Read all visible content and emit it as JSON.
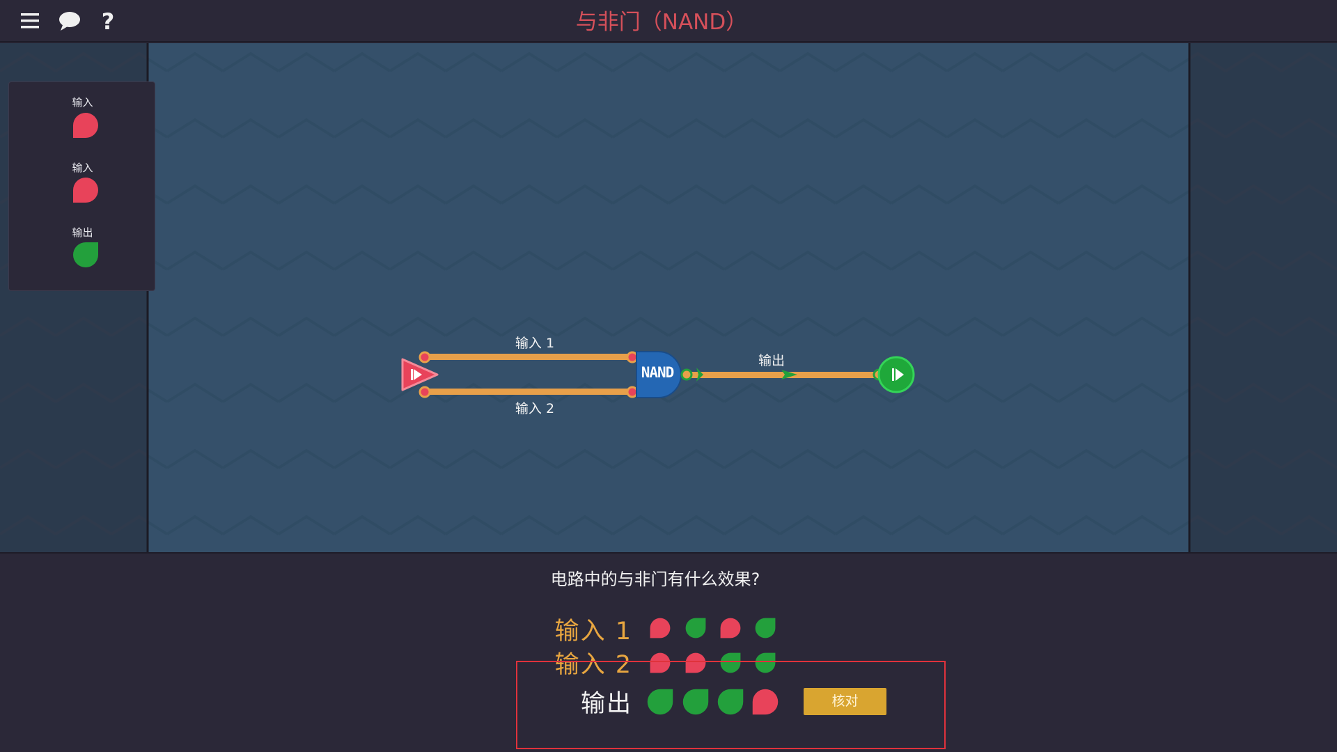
{
  "header": {
    "title": "与非门（NAND）",
    "icons": [
      "menu-icon",
      "chat-icon",
      "help-icon"
    ]
  },
  "palette": {
    "items": [
      {
        "label": "输入",
        "color": "red"
      },
      {
        "label": "输入",
        "color": "red"
      },
      {
        "label": "输出",
        "color": "green"
      }
    ]
  },
  "circuit": {
    "gate_label": "NAND",
    "wire_labels": {
      "input1": "输入 1",
      "input2": "输入 2",
      "output": "输出"
    }
  },
  "quiz": {
    "question": "电路中的与非门有什么效果?",
    "rows": [
      {
        "label": "输入 1",
        "values": [
          "red",
          "green",
          "red",
          "green"
        ]
      },
      {
        "label": "输入 2",
        "values": [
          "red",
          "red",
          "green",
          "green"
        ]
      },
      {
        "label": "输出",
        "values": [
          "green",
          "green",
          "green",
          "red"
        ]
      }
    ],
    "check_label": "核对"
  },
  "colors": {
    "red": "#e8435a",
    "green": "#23a03c",
    "wire": "#e8a04a",
    "accent_title": "#d6505a",
    "label_orange": "#e8a640",
    "button": "#d9a530"
  }
}
